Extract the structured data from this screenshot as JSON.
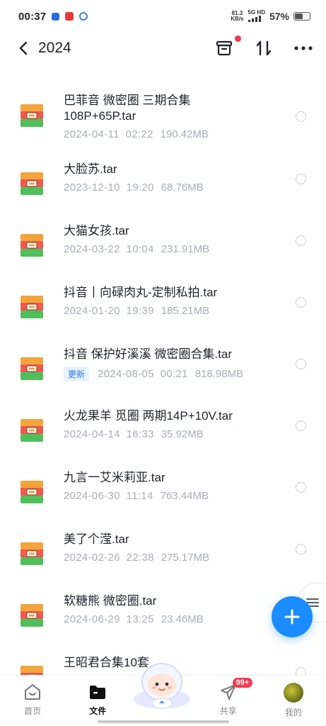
{
  "status": {
    "time": "00:37",
    "net_speed_value": "81.3",
    "net_speed_unit": "KB/s",
    "signal_label": "5G HD",
    "battery": "57%",
    "battery_level": 0.57
  },
  "header": {
    "title": "2024",
    "archive_icon": "archive-icon",
    "sort_icon": "sort-icon",
    "more_icon": "more-icon"
  },
  "files": [
    {
      "name": "巴菲音 微密圈 三期合集108P+65P.tar",
      "date": "2024-04-11",
      "time": "02:22",
      "size": "190.42MB"
    },
    {
      "name": "大脸苏.tar",
      "date": "2023-12-10",
      "time": "19:20",
      "size": "68.76MB"
    },
    {
      "name": "大猫女孩.tar",
      "date": "2024-03-22",
      "time": "10:04",
      "size": "231.91MB"
    },
    {
      "name": "抖音丨向碌肉丸-定制私拍.tar",
      "date": "2024-01-20",
      "time": "19:39",
      "size": "185.21MB"
    },
    {
      "name": "抖音 保护好溪溪 微密圈合集.tar",
      "badge": "更新",
      "date": "2024-08-05",
      "time": "00:21",
      "size": "818.98MB"
    },
    {
      "name": "火龙果羊 觅圈 两期14P+10V.tar",
      "date": "2024-04-14",
      "time": "16:33",
      "size": "35.92MB"
    },
    {
      "name": "九言一艾米莉亚.tar",
      "date": "2024-06-30",
      "time": "11:14",
      "size": "763.44MB"
    },
    {
      "name": "美了个滢.tar",
      "date": "2024-02-26",
      "time": "22:38",
      "size": "275.17MB"
    },
    {
      "name": "软糖熊 微密圈.tar",
      "date": "2024-06-29",
      "time": "13:25",
      "size": "23.46MB"
    },
    {
      "name": "王昭君合集10套",
      "date": "",
      "time": "",
      "size": ""
    }
  ],
  "nav": {
    "home": "首页",
    "files": "文件",
    "share": "共享",
    "share_badge": "99+",
    "mine": "我的"
  },
  "colors": {
    "accent": "#1b8cff",
    "badge_red": "#f5384f",
    "meta_gray": "#a8adb5"
  }
}
